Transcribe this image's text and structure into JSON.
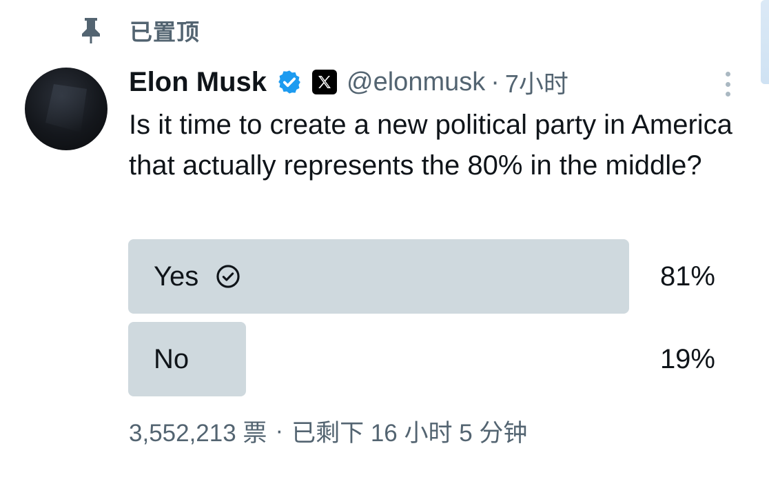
{
  "pinned": {
    "label": "已置顶"
  },
  "author": {
    "name": "Elon Musk",
    "handle": "@elonmusk",
    "separator": "·",
    "time": "7小时"
  },
  "tweet": {
    "text": "Is it time to create a new political party in America that actually represents the 80% in the middle?"
  },
  "poll": {
    "options": [
      {
        "label": "Yes",
        "percent_label": "81%",
        "percent": 81,
        "selected": true
      },
      {
        "label": "No",
        "percent_label": "19%",
        "percent": 19,
        "selected": false
      }
    ],
    "votes": "3,552,213 票",
    "separator": "·",
    "remaining": "已剩下 16 小时 5 分钟"
  },
  "colors": {
    "bar": "#cfd9de",
    "verified": "#1d9bf0",
    "muted": "#536471"
  },
  "icons": {
    "pin": "pin-icon",
    "verified": "verified-icon",
    "x_badge": "x-logo-icon",
    "more": "more-vertical-icon",
    "check": "check-circle-icon"
  }
}
